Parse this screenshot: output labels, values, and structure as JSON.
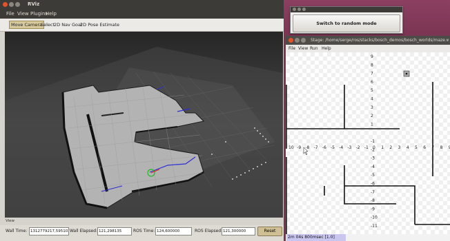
{
  "rviz": {
    "title": "RViz",
    "menu": [
      "File",
      "View",
      "Plugins",
      "Help"
    ],
    "tools": [
      "Move Camera",
      "Select",
      "2D Nav Goal",
      "2D Pose Estimate"
    ],
    "active_tool": "Move Camera",
    "view_label": "View",
    "status": {
      "wall_time_label": "Wall Time:",
      "wall_time_value": "1312779217,595102",
      "wall_elapsed_label": "Wall Elapsed:",
      "wall_elapsed_value": "121,298135",
      "ros_time_label": "ROS Time:",
      "ros_time_value": "124,600000",
      "ros_elapsed_label": "ROS Elapsed:",
      "ros_elapsed_value": "121,300000",
      "reset_label": "Reset"
    }
  },
  "random_mode": {
    "button_label": "Switch to random mode"
  },
  "stage": {
    "title": "Stage: /home/serge/ros/stacks/bosch_demos/bosch_worlds/maze.world",
    "menu": [
      "File",
      "View",
      "Run",
      "Help"
    ],
    "status_text": "2m 04s 800msec [1.0]",
    "x_axis_labels": [
      "10",
      "-9",
      "-8",
      "-7",
      "-6",
      "-5",
      "-4",
      "-3",
      "-2",
      "-1",
      "0",
      "1",
      "2",
      "3",
      "4",
      "5",
      "6",
      "7",
      "8",
      "9"
    ],
    "y_axis_labels": [
      "9",
      "8",
      "7",
      "6",
      "5",
      "4",
      "3",
      "2",
      "1",
      "-1",
      "-2",
      "-3",
      "-4",
      "-5",
      "-6",
      "-7",
      "-8",
      "-9",
      "-10",
      "-11"
    ]
  },
  "colors": {
    "ubuntu_panel": "#3c3b37",
    "desktop_bg": "#7a3552",
    "active_tool": "#d7c99c",
    "status_highlight": "#c9c6f0"
  }
}
